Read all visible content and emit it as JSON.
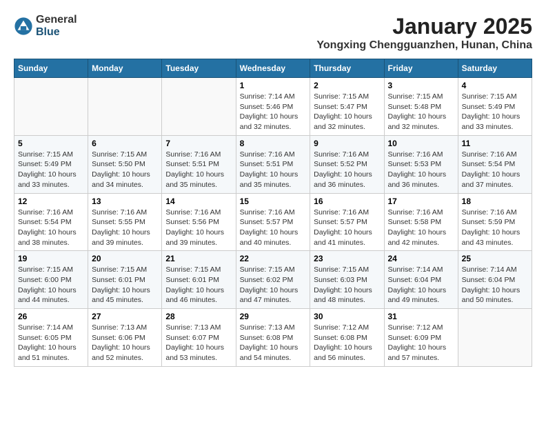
{
  "header": {
    "logo_general": "General",
    "logo_blue": "Blue",
    "month_title": "January 2025",
    "location": "Yongxing Chengguanzhen, Hunan, China"
  },
  "weekdays": [
    "Sunday",
    "Monday",
    "Tuesday",
    "Wednesday",
    "Thursday",
    "Friday",
    "Saturday"
  ],
  "weeks": [
    [
      {
        "day": "",
        "info": ""
      },
      {
        "day": "",
        "info": ""
      },
      {
        "day": "",
        "info": ""
      },
      {
        "day": "1",
        "info": "Sunrise: 7:14 AM\nSunset: 5:46 PM\nDaylight: 10 hours\nand 32 minutes."
      },
      {
        "day": "2",
        "info": "Sunrise: 7:15 AM\nSunset: 5:47 PM\nDaylight: 10 hours\nand 32 minutes."
      },
      {
        "day": "3",
        "info": "Sunrise: 7:15 AM\nSunset: 5:48 PM\nDaylight: 10 hours\nand 32 minutes."
      },
      {
        "day": "4",
        "info": "Sunrise: 7:15 AM\nSunset: 5:49 PM\nDaylight: 10 hours\nand 33 minutes."
      }
    ],
    [
      {
        "day": "5",
        "info": "Sunrise: 7:15 AM\nSunset: 5:49 PM\nDaylight: 10 hours\nand 33 minutes."
      },
      {
        "day": "6",
        "info": "Sunrise: 7:15 AM\nSunset: 5:50 PM\nDaylight: 10 hours\nand 34 minutes."
      },
      {
        "day": "7",
        "info": "Sunrise: 7:16 AM\nSunset: 5:51 PM\nDaylight: 10 hours\nand 35 minutes."
      },
      {
        "day": "8",
        "info": "Sunrise: 7:16 AM\nSunset: 5:51 PM\nDaylight: 10 hours\nand 35 minutes."
      },
      {
        "day": "9",
        "info": "Sunrise: 7:16 AM\nSunset: 5:52 PM\nDaylight: 10 hours\nand 36 minutes."
      },
      {
        "day": "10",
        "info": "Sunrise: 7:16 AM\nSunset: 5:53 PM\nDaylight: 10 hours\nand 36 minutes."
      },
      {
        "day": "11",
        "info": "Sunrise: 7:16 AM\nSunset: 5:54 PM\nDaylight: 10 hours\nand 37 minutes."
      }
    ],
    [
      {
        "day": "12",
        "info": "Sunrise: 7:16 AM\nSunset: 5:54 PM\nDaylight: 10 hours\nand 38 minutes."
      },
      {
        "day": "13",
        "info": "Sunrise: 7:16 AM\nSunset: 5:55 PM\nDaylight: 10 hours\nand 39 minutes."
      },
      {
        "day": "14",
        "info": "Sunrise: 7:16 AM\nSunset: 5:56 PM\nDaylight: 10 hours\nand 39 minutes."
      },
      {
        "day": "15",
        "info": "Sunrise: 7:16 AM\nSunset: 5:57 PM\nDaylight: 10 hours\nand 40 minutes."
      },
      {
        "day": "16",
        "info": "Sunrise: 7:16 AM\nSunset: 5:57 PM\nDaylight: 10 hours\nand 41 minutes."
      },
      {
        "day": "17",
        "info": "Sunrise: 7:16 AM\nSunset: 5:58 PM\nDaylight: 10 hours\nand 42 minutes."
      },
      {
        "day": "18",
        "info": "Sunrise: 7:16 AM\nSunset: 5:59 PM\nDaylight: 10 hours\nand 43 minutes."
      }
    ],
    [
      {
        "day": "19",
        "info": "Sunrise: 7:15 AM\nSunset: 6:00 PM\nDaylight: 10 hours\nand 44 minutes."
      },
      {
        "day": "20",
        "info": "Sunrise: 7:15 AM\nSunset: 6:01 PM\nDaylight: 10 hours\nand 45 minutes."
      },
      {
        "day": "21",
        "info": "Sunrise: 7:15 AM\nSunset: 6:01 PM\nDaylight: 10 hours\nand 46 minutes."
      },
      {
        "day": "22",
        "info": "Sunrise: 7:15 AM\nSunset: 6:02 PM\nDaylight: 10 hours\nand 47 minutes."
      },
      {
        "day": "23",
        "info": "Sunrise: 7:15 AM\nSunset: 6:03 PM\nDaylight: 10 hours\nand 48 minutes."
      },
      {
        "day": "24",
        "info": "Sunrise: 7:14 AM\nSunset: 6:04 PM\nDaylight: 10 hours\nand 49 minutes."
      },
      {
        "day": "25",
        "info": "Sunrise: 7:14 AM\nSunset: 6:04 PM\nDaylight: 10 hours\nand 50 minutes."
      }
    ],
    [
      {
        "day": "26",
        "info": "Sunrise: 7:14 AM\nSunset: 6:05 PM\nDaylight: 10 hours\nand 51 minutes."
      },
      {
        "day": "27",
        "info": "Sunrise: 7:13 AM\nSunset: 6:06 PM\nDaylight: 10 hours\nand 52 minutes."
      },
      {
        "day": "28",
        "info": "Sunrise: 7:13 AM\nSunset: 6:07 PM\nDaylight: 10 hours\nand 53 minutes."
      },
      {
        "day": "29",
        "info": "Sunrise: 7:13 AM\nSunset: 6:08 PM\nDaylight: 10 hours\nand 54 minutes."
      },
      {
        "day": "30",
        "info": "Sunrise: 7:12 AM\nSunset: 6:08 PM\nDaylight: 10 hours\nand 56 minutes."
      },
      {
        "day": "31",
        "info": "Sunrise: 7:12 AM\nSunset: 6:09 PM\nDaylight: 10 hours\nand 57 minutes."
      },
      {
        "day": "",
        "info": ""
      }
    ]
  ]
}
